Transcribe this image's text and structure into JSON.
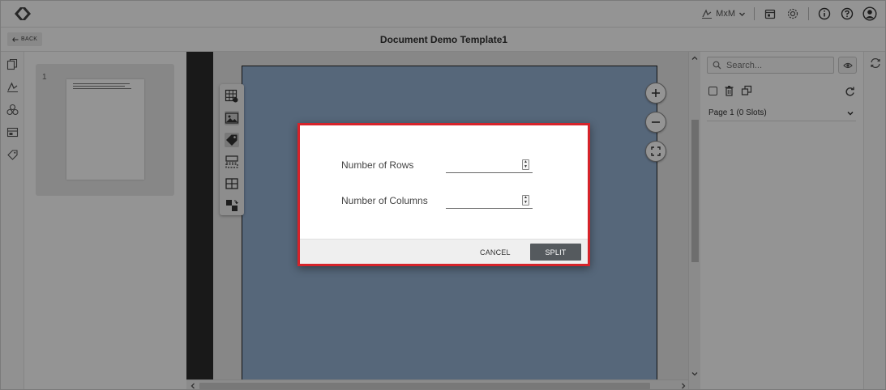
{
  "app": {
    "user_label": "MxM",
    "back_label": "BACK",
    "document_title": "Document Demo Template1"
  },
  "thumbnails": [
    {
      "page_number": "1"
    }
  ],
  "right_panel": {
    "search_placeholder": "Search...",
    "page_group_label": "Page 1 (0 Slots)"
  },
  "dialog": {
    "rows_label": "Number of Rows",
    "rows_value": "",
    "columns_label": "Number of Columns",
    "columns_value": "",
    "cancel_label": "CANCEL",
    "split_label": "SPLIT"
  },
  "colors": {
    "dialog_border": "#d6232a",
    "primary_button": "#555a5e",
    "page_fill": "#95b1d2"
  }
}
